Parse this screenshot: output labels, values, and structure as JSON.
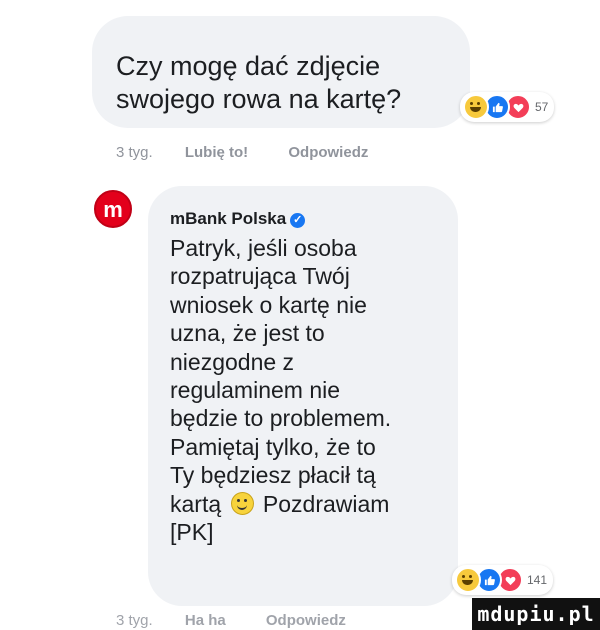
{
  "comment": {
    "text_lines": [
      "Czy mogę dać zdjęcie",
      "swojego rowa na kartę?"
    ],
    "reaction_count": "57",
    "time": "3 tyg.",
    "like_label": "Lubię to!",
    "reply_label": "Odpowiedz"
  },
  "reply": {
    "author": "mBank Polska",
    "avatar_letter": "m",
    "lines": [
      "Patryk, jeśli osoba",
      "rozpatrująca Twój",
      "wniosek o kartę nie",
      "uzna, że jest to",
      "niezgodne z",
      "regulaminem nie",
      "będzie to problemem.",
      "Pamiętaj tylko, że to",
      "Ty będziesz płacił tą"
    ],
    "line_before_emoji": "kartą",
    "line_after_emoji": "Pozdrawiam",
    "signature": "[PK]",
    "reaction_count": "141",
    "time": "3 tyg.",
    "haha_label": "Ha ha",
    "reply_label": "Odpowiedz"
  },
  "watermark": "mdupiu.pl",
  "colors": {
    "bubble": "#f0f2f5",
    "like": "#1877f2",
    "love": "#f33e58",
    "haha": "#f7c93c",
    "mbank": "#e3001b"
  }
}
